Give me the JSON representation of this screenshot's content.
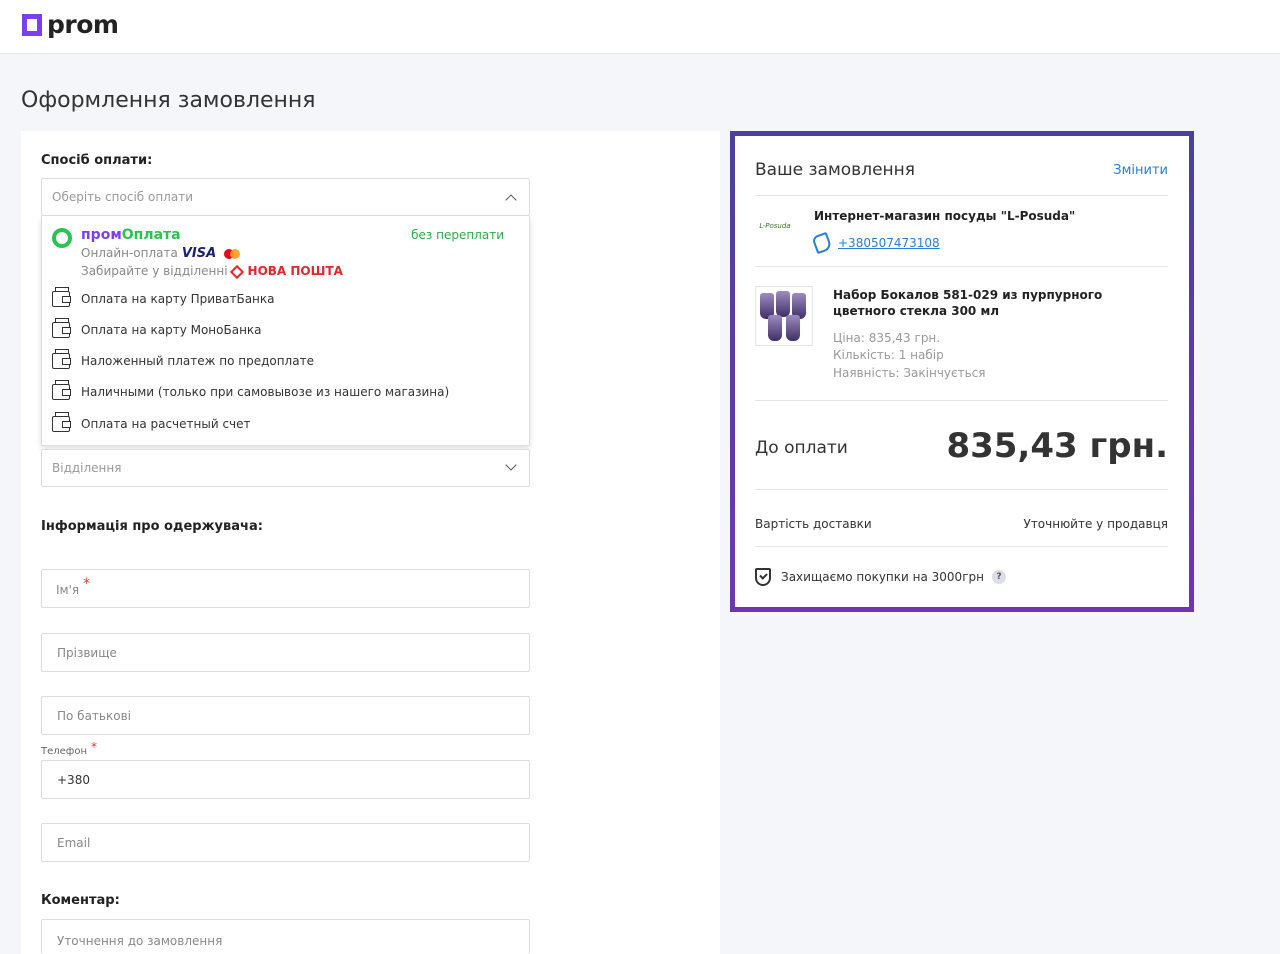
{
  "header": {
    "logo_text": "prom",
    "brand_color": "#7b3ff2"
  },
  "page": {
    "title": "Оформлення замовлення"
  },
  "payment": {
    "section_label": "Спосіб оплати:",
    "select_placeholder": "Оберіть спосіб оплати",
    "promo": {
      "title_part1": "пром",
      "title_part2": "Оплата",
      "badge": "без переплати",
      "line1": "Онлайн-оплата",
      "visa": "VISA",
      "line2": "Забирайте у відділенні",
      "nova_poshta": "НОВА ПОШТА"
    },
    "options": [
      "Оплата на карту ПриватБанка",
      "Оплата на карту МоноБанка",
      "Наложенный платеж по предоплате",
      "Наличными (только при самовывозе из нашего магазина)",
      "Оплата на расчетный счет"
    ],
    "branch_placeholder": "Відділення"
  },
  "recipient": {
    "section_label": "Інформація про одержувача:",
    "first_name_placeholder": "Ім'я",
    "last_name_placeholder": "Прізвище",
    "patronymic_placeholder": "По батькові",
    "phone_label": "Телефон",
    "phone_value": "+380",
    "email_placeholder": "Email",
    "required_mark": "*"
  },
  "comment": {
    "section_label": "Коментар:",
    "placeholder": "Уточнення до замовлення"
  },
  "order": {
    "title": "Ваше замовлення",
    "edit_label": "Змінити",
    "shop_logo_text": "L-Posuda",
    "shop_name": "Интернет-магазин посуды \"L-Posuda\"",
    "shop_phone": "+380507473108",
    "product_name": "Набор Бокалов 581-029 из пурпурного цветного стекла 300 мл",
    "price": "Ціна: 835,43 грн.",
    "quantity": "Кількість: 1 набір",
    "availability": "Наявність: Закінчується",
    "total_label": "До оплати",
    "total_value": "835,43 грн.",
    "delivery_label": "Вартість доставки",
    "delivery_value": "Уточнюйте у продавця",
    "protection_text": "Захищаємо покупки на 3000грн",
    "help": "?"
  }
}
